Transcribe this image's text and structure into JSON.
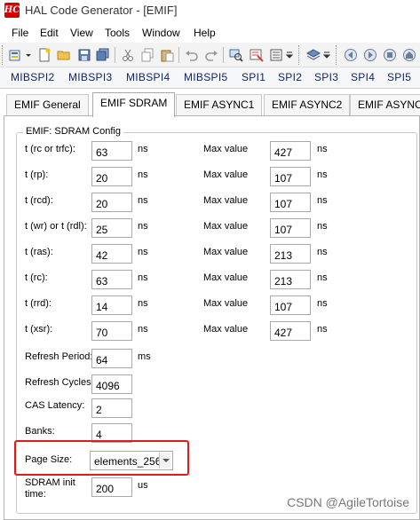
{
  "window": {
    "app_icon_text": "HC",
    "title": "HAL Code Generator  - [EMIF]"
  },
  "menu": [
    "File",
    "Edit",
    "View",
    "Tools",
    "Window",
    "Help"
  ],
  "module_bar": [
    "MIBSPI2",
    "MIBSPI3",
    "MIBSPI4",
    "MIBSPI5",
    "SPI1",
    "SPI2",
    "SPI3",
    "SPI4",
    "SPI5"
  ],
  "tabs": [
    "EMIF General",
    "EMIF SDRAM",
    "EMIF ASYNC1",
    "EMIF ASYNC2",
    "EMIF ASYNC3"
  ],
  "active_tab": "EMIF SDRAM",
  "group": {
    "title": "EMIF: SDRAM Config"
  },
  "timing": [
    {
      "label": "t (rc or trfc):",
      "value": "63",
      "unit": "ns",
      "max_label": "Max value",
      "max": "427",
      "max_unit": "ns"
    },
    {
      "label": "t (rp):",
      "value": "20",
      "unit": "ns",
      "max_label": "Max value",
      "max": "107",
      "max_unit": "ns"
    },
    {
      "label": "t (rcd):",
      "value": "20",
      "unit": "ns",
      "max_label": "Max value",
      "max": "107",
      "max_unit": "ns"
    },
    {
      "label": "t (wr) or t (rdl):",
      "value": "25",
      "unit": "ns",
      "max_label": "Max value",
      "max": "107",
      "max_unit": "ns"
    },
    {
      "label": "t (ras):",
      "value": "42",
      "unit": "ns",
      "max_label": "Max value",
      "max": "213",
      "max_unit": "ns"
    },
    {
      "label": "t (rc):",
      "value": "63",
      "unit": "ns",
      "max_label": "Max value",
      "max": "213",
      "max_unit": "ns"
    },
    {
      "label": "t (rrd):",
      "value": "14",
      "unit": "ns",
      "max_label": "Max value",
      "max": "107",
      "max_unit": "ns"
    },
    {
      "label": "t (xsr):",
      "value": "70",
      "unit": "ns",
      "max_label": "Max value",
      "max": "427",
      "max_unit": "ns"
    }
  ],
  "refresh_period": {
    "label": "Refresh Period:",
    "value": "64",
    "unit": "ms"
  },
  "refresh_cycles": {
    "label": "Refresh Cycles:",
    "value": "4096"
  },
  "cas_latency": {
    "label": "CAS Latency:",
    "value": "2"
  },
  "banks": {
    "label": "Banks:",
    "value": "4"
  },
  "page_size": {
    "label": "Page Size:",
    "value": "elements_256"
  },
  "sdram_init": {
    "label_line1": "SDRAM init",
    "label_line2": "time:",
    "value": "200",
    "unit": "us"
  },
  "watermark": "CSDN @AgileTortoise",
  "colors": {
    "highlight": "#e01b1b",
    "app_icon": "#d40000"
  }
}
